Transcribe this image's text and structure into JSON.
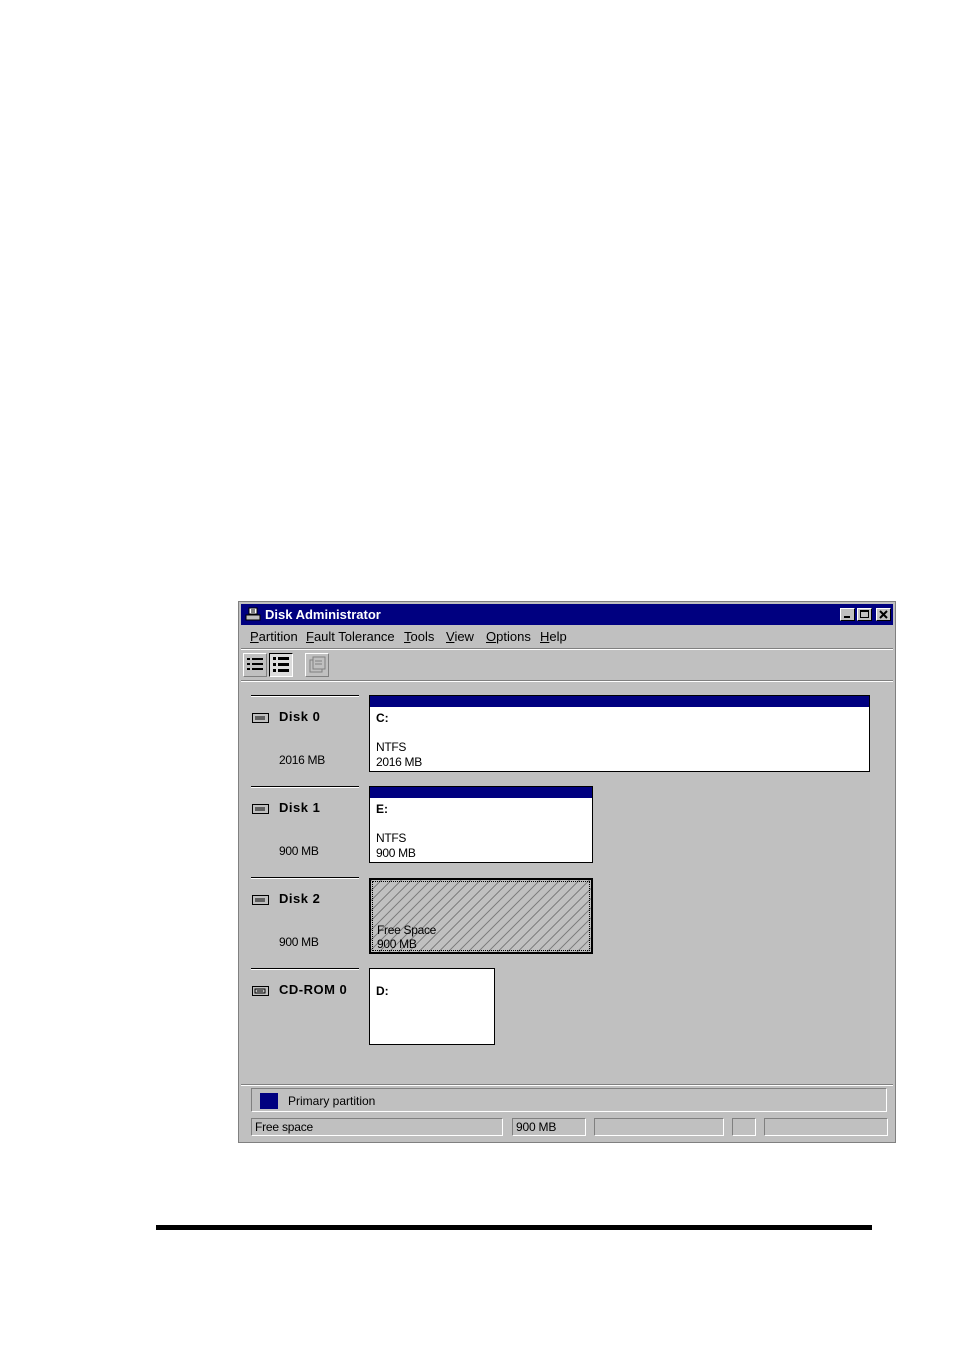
{
  "window": {
    "title": "Disk Administrator",
    "controls": {
      "minimize": "_",
      "maximize": "□",
      "close": "×"
    }
  },
  "menu": [
    {
      "label": "Partition",
      "mnemonic": "P"
    },
    {
      "label": "Fault Tolerance",
      "mnemonic": "F"
    },
    {
      "label": "Tools",
      "mnemonic": "T"
    },
    {
      "label": "View",
      "mnemonic": "V"
    },
    {
      "label": "Options",
      "mnemonic": "O"
    },
    {
      "label": "Help",
      "mnemonic": "H"
    }
  ],
  "toolbar": {
    "buttons": [
      {
        "icon": "volumes-view-icon",
        "state": "raised"
      },
      {
        "icon": "disk-configuration-view-icon",
        "state": "pressed"
      },
      {
        "icon": "properties-icon",
        "state": "disabled"
      }
    ]
  },
  "disks": [
    {
      "name": "Disk 0",
      "size": "2016 MB",
      "icon": "hard-disk-icon",
      "partition": {
        "letter": "C:",
        "filesystem": "NTFS",
        "size": "2016 MB",
        "type": "primary"
      }
    },
    {
      "name": "Disk 1",
      "size": "900 MB",
      "icon": "hard-disk-icon",
      "partition": {
        "letter": "E:",
        "filesystem": "NTFS",
        "size": "900 MB",
        "type": "primary"
      }
    },
    {
      "name": "Disk 2",
      "size": "900 MB",
      "icon": "hard-disk-icon",
      "partition": {
        "label": "Free Space",
        "size": "900 MB",
        "type": "free",
        "selected": true
      }
    },
    {
      "name": "CD-ROM 0",
      "icon": "cdrom-icon",
      "partition": {
        "letter": "D:",
        "type": "cdrom"
      }
    }
  ],
  "legend": {
    "label": "Primary partition",
    "color": "#000080"
  },
  "statusbar": {
    "selection": "Free space",
    "size": "900 MB",
    "field3": "",
    "field4": "",
    "field5": ""
  },
  "colors": {
    "titlebar": "#000080",
    "face": "#c0c0c0",
    "primary_partition": "#000080"
  }
}
